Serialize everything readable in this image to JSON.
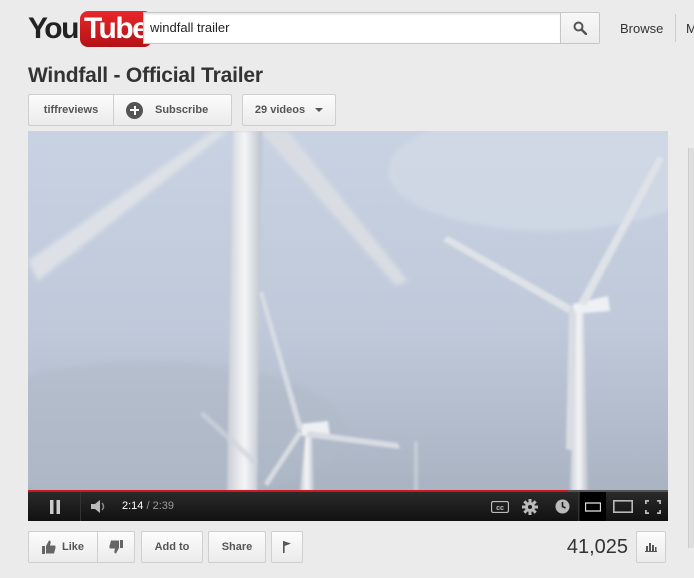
{
  "header": {
    "logo_you": "You",
    "logo_tube": "Tube",
    "search_value": "windfall trailer",
    "browse_label": "Browse",
    "cut_off_link": "M"
  },
  "video": {
    "title": "Windfall - Official Trailer",
    "channel": "tiffreviews",
    "subscribe_label": "Subscribe",
    "videos_label": "29 videos",
    "current_time": "2:14",
    "duration": "2:39",
    "progress_fraction": 0.843,
    "views": "41,025"
  },
  "actions": {
    "like_label": "Like",
    "addto_label": "Add to",
    "share_label": "Share"
  },
  "colors": {
    "brand_red": "#cc181e",
    "background": "#ebebeb"
  },
  "icons": [
    "search-icon",
    "plus-icon",
    "chevron-down-icon",
    "pause-icon",
    "volume-icon",
    "cc-icon",
    "gear-icon",
    "clock-icon",
    "small-player-icon",
    "large-player-icon",
    "fullscreen-icon",
    "thumbs-up-icon",
    "thumbs-down-icon",
    "flag-icon",
    "stats-icon"
  ]
}
